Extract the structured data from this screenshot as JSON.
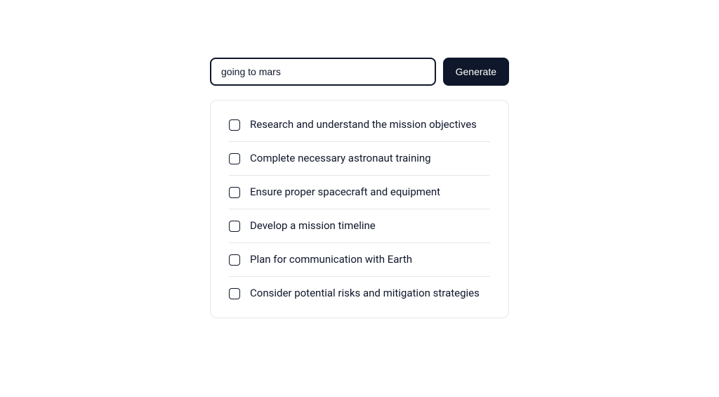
{
  "input": {
    "value": "going to mars",
    "placeholder": ""
  },
  "button": {
    "label": "Generate"
  },
  "todos": [
    {
      "label": "Research and understand the mission objectives",
      "checked": false
    },
    {
      "label": "Complete necessary astronaut training",
      "checked": false
    },
    {
      "label": "Ensure proper spacecraft and equipment",
      "checked": false
    },
    {
      "label": "Develop a mission timeline",
      "checked": false
    },
    {
      "label": "Plan for communication with Earth",
      "checked": false
    },
    {
      "label": "Consider potential risks and mitigation strategies",
      "checked": false
    }
  ]
}
